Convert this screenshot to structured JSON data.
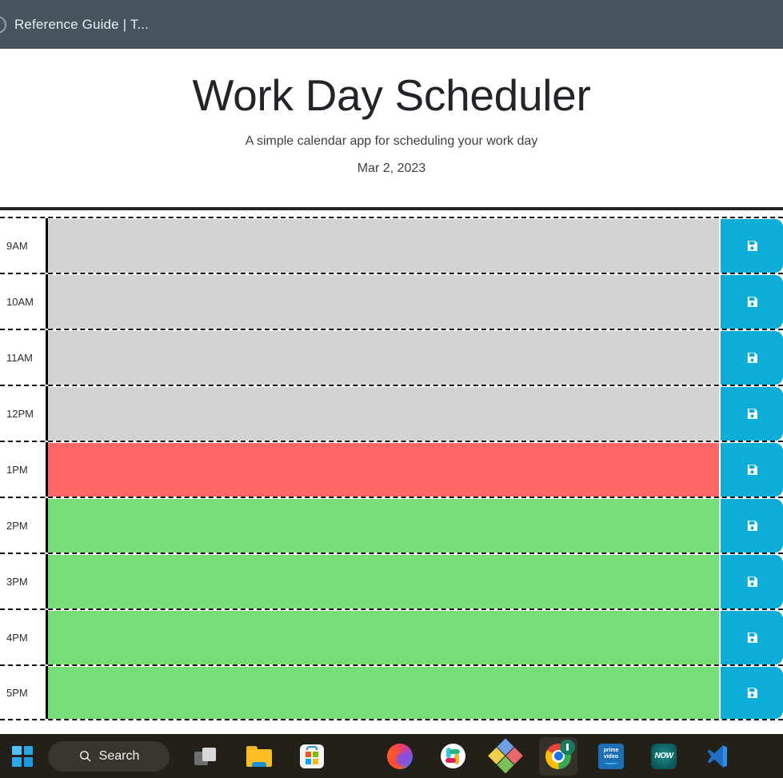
{
  "browser": {
    "tab_title": "Reference Guide | T...",
    "favicon_name": "page-favicon",
    "bar_color": "#45545d"
  },
  "header": {
    "title": "Work Day Scheduler",
    "subtitle": "A simple calendar app for scheduling your work day",
    "date": "Mar 2, 2023"
  },
  "scheduler": {
    "save_icon_name": "save-floppy-icon",
    "colors": {
      "past": "#d3d3d3",
      "present": "#ff6666",
      "future": "#77dd77",
      "save_button": "#0cadd6"
    },
    "blocks": [
      {
        "hour": "9AM",
        "state": "past",
        "text": ""
      },
      {
        "hour": "10AM",
        "state": "past",
        "text": ""
      },
      {
        "hour": "11AM",
        "state": "past",
        "text": ""
      },
      {
        "hour": "12PM",
        "state": "past",
        "text": ""
      },
      {
        "hour": "1PM",
        "state": "present",
        "text": ""
      },
      {
        "hour": "2PM",
        "state": "future",
        "text": ""
      },
      {
        "hour": "3PM",
        "state": "future",
        "text": ""
      },
      {
        "hour": "4PM",
        "state": "future",
        "text": ""
      },
      {
        "hour": "5PM",
        "state": "future",
        "text": ""
      }
    ]
  },
  "taskbar": {
    "start_label": "Start",
    "search_label": "Search",
    "items": [
      {
        "name": "task-view-icon",
        "label": "Task View"
      },
      {
        "name": "file-explorer-icon",
        "label": "File Explorer"
      },
      {
        "name": "microsoft-store-icon",
        "label": "Microsoft Store"
      },
      {
        "name": "firefox-icon",
        "label": "Firefox"
      },
      {
        "name": "slack-icon",
        "label": "Slack"
      },
      {
        "name": "diamond-app-icon",
        "label": "App"
      },
      {
        "name": "google-chrome-icon",
        "label": "Google Chrome"
      },
      {
        "name": "prime-video-icon",
        "label": "Prime Video"
      },
      {
        "name": "now-tv-icon",
        "label": "NOW"
      },
      {
        "name": "vs-code-icon",
        "label": "Visual Studio Code"
      }
    ],
    "prime_line1": "prime",
    "prime_line2": "video",
    "now_label": "NOW"
  }
}
